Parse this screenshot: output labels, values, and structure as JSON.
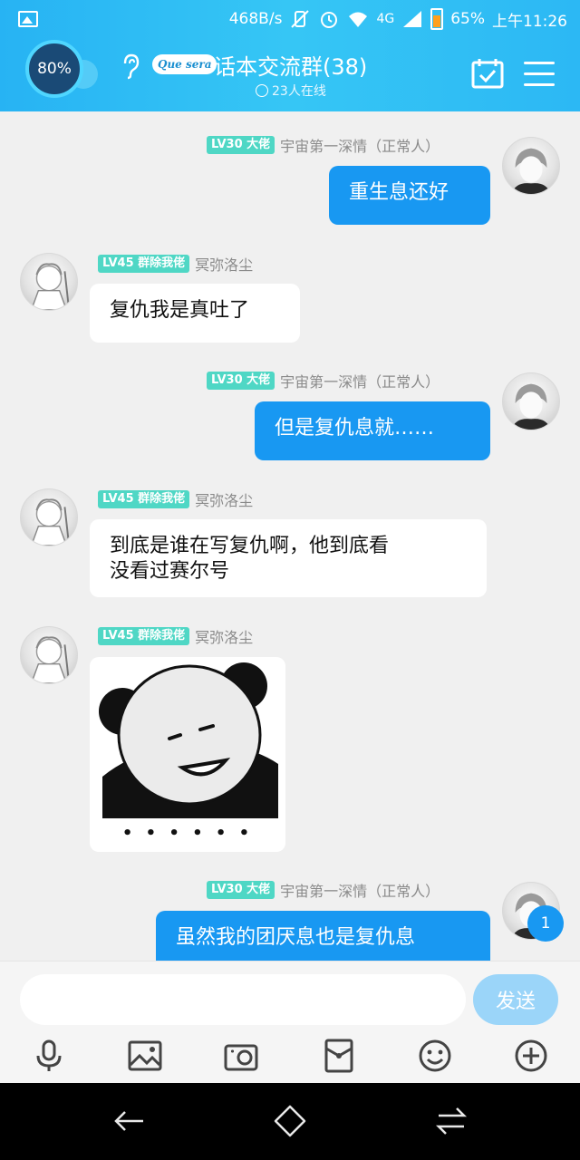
{
  "status_bar": {
    "net_speed": "468B/s",
    "network": "4G",
    "battery": "65%",
    "time": "上午11:26",
    "battery_level": 0.65
  },
  "header": {
    "progress": "80%",
    "brand": "Que sera",
    "title": "话本交流群(38)",
    "online": "23人在线"
  },
  "messages": [
    {
      "side": "right",
      "badge": "LV30 大佬",
      "name": "宇宙第一深情（正常人）",
      "text": "重生息还好"
    },
    {
      "side": "left",
      "badge": "LV45 群除我佬",
      "name": "冥弥洛尘",
      "text": "复仇我是真吐了"
    },
    {
      "side": "right",
      "badge": "LV30 大佬",
      "name": "宇宙第一深情（正常人）",
      "text": "但是复仇息就……"
    },
    {
      "side": "left",
      "badge": "LV45 群除我佬",
      "name": "冥弥洛尘",
      "text": "到底是谁在写复仇啊，他到底看\n没看过赛尔号"
    },
    {
      "side": "left",
      "badge": "LV45 群除我佬",
      "name": "冥弥洛尘",
      "sticker": "panda-meme",
      "sticker_text": "• • • • • •"
    },
    {
      "side": "right",
      "badge": "LV30 大佬",
      "name": "宇宙第一深情（正常人）",
      "text": "虽然我的团厌息也是复仇息"
    }
  ],
  "unread_count": "1",
  "input": {
    "placeholder": "",
    "value": "",
    "send_label": "发送"
  },
  "toolbar_icons": [
    "microphone-icon",
    "image-icon",
    "camera-icon",
    "red-packet-icon",
    "emoji-icon",
    "plus-icon"
  ],
  "colors": {
    "header": "#2cb8f4",
    "bubble_right": "#1898f2",
    "bubble_left": "#ffffff",
    "badge": "#4fd7c5"
  }
}
